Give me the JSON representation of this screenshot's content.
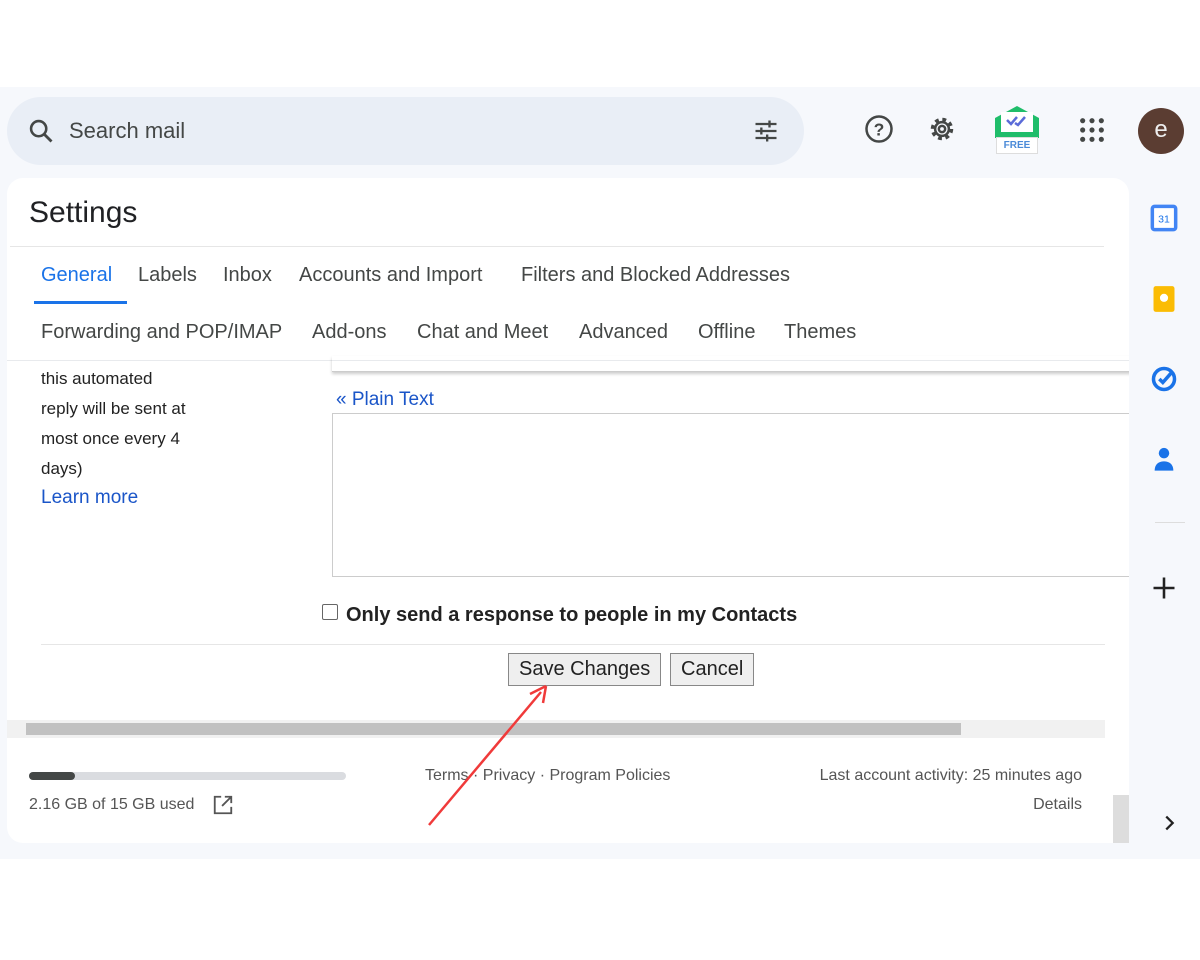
{
  "search": {
    "placeholder": "Search mail"
  },
  "header": {
    "avatar_letter": "e",
    "extension_badge": "FREE"
  },
  "settings": {
    "title": "Settings",
    "tabs": [
      "General",
      "Labels",
      "Inbox",
      "Accounts and Import",
      "Filters and Blocked Addresses",
      "Forwarding and POP/IMAP",
      "Add-ons",
      "Chat and Meet",
      "Advanced",
      "Offline",
      "Themes"
    ],
    "active_tab": "General"
  },
  "vacation": {
    "side_lines": [
      "this automated",
      "reply will be sent at",
      "most once every 4",
      "days)"
    ],
    "learn_more": "Learn more",
    "plain_text": "« Plain Text",
    "contacts_only_label": "Only send a response to people in my Contacts",
    "contacts_only_checked": false
  },
  "buttons": {
    "save": "Save Changes",
    "cancel": "Cancel"
  },
  "footer": {
    "storage_used": "2.16 GB of 15 GB used",
    "storage_fraction": 0.144,
    "terms": "Terms",
    "privacy": "Privacy",
    "policies": "Program Policies",
    "sep": "·",
    "activity": "Last account activity: 25 minutes ago",
    "details": "Details"
  },
  "colors": {
    "accent": "#1a73e8",
    "annotation_arrow": "#f03a3a"
  }
}
